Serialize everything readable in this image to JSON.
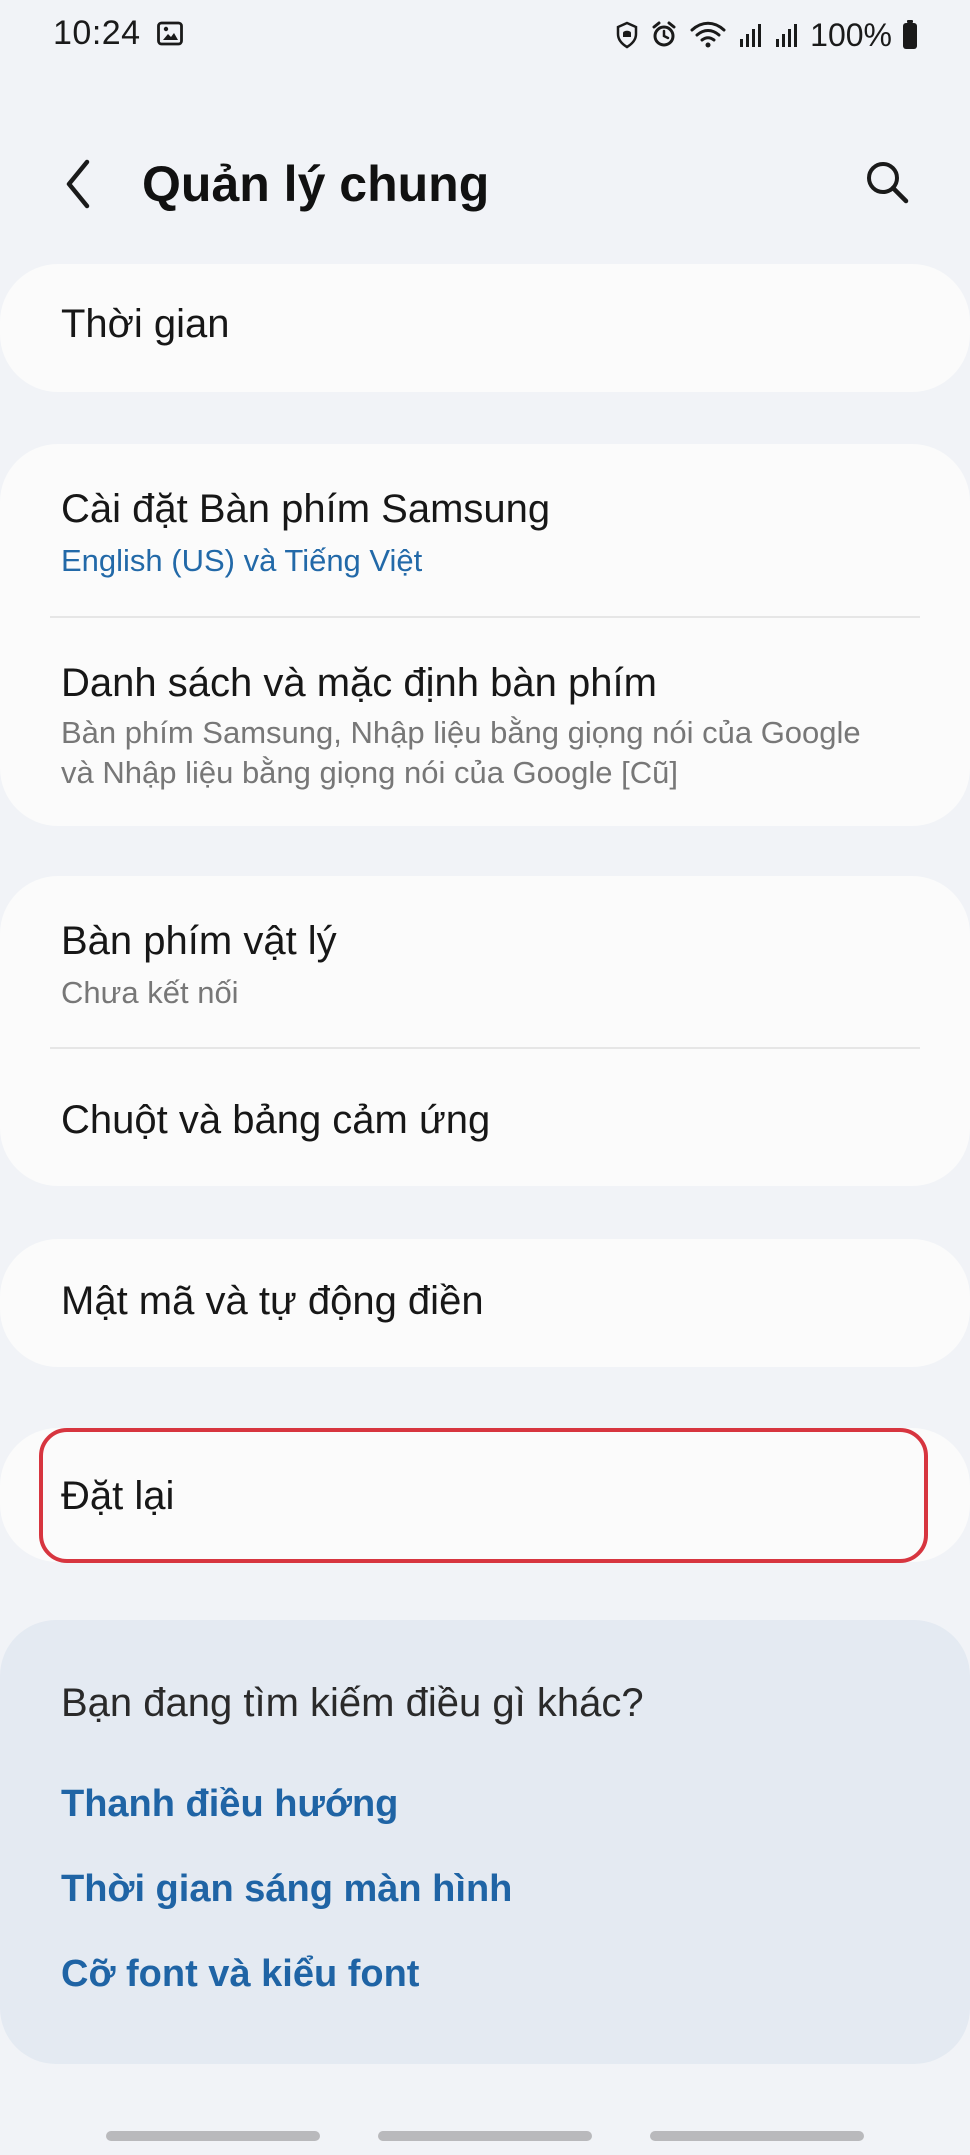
{
  "status_bar": {
    "time": "10:24",
    "battery": "100%",
    "icons": [
      "image-icon",
      "privacy-icon",
      "alarm-icon",
      "wifi-icon",
      "signal-icon",
      "signal-icon",
      "battery-icon"
    ]
  },
  "header": {
    "title": "Quản lý chung",
    "back_icon": "back-icon",
    "search_icon": "search-icon"
  },
  "settings": {
    "time": {
      "title": "Thời gian"
    },
    "samsung_keyboard": {
      "title": "Cài đặt Bàn phím Samsung",
      "subtitle": "English (US) và Tiếng Việt"
    },
    "keyboard_list": {
      "title": "Danh sách và mặc định bàn phím",
      "subtitle_line1": "Bàn phím Samsung, Nhập liệu bằng giọng nói của Google",
      "subtitle_line2": "và Nhập liệu bằng giọng nói của Google [Cũ]"
    },
    "physical_keyboard": {
      "title": "Bàn phím vật lý",
      "subtitle": "Chưa kết nối"
    },
    "mouse_trackpad": {
      "title": "Chuột và bảng cảm ứng"
    },
    "password_autofill": {
      "title": "Mật mã và tự động điền"
    },
    "reset": {
      "title": "Đặt lại"
    }
  },
  "suggestions": {
    "title": "Bạn đang tìm kiếm điều gì khác?",
    "links": [
      "Thanh điều hướng",
      "Thời gian sáng màn hình",
      "Cỡ font và kiểu font"
    ]
  },
  "colors": {
    "background": "#f1f3f7",
    "card": "#fbfbfb",
    "suggestion_card": "#e4eaf2",
    "accent_blue": "#1f64a5",
    "highlight_red": "#d7353f",
    "secondary_text": "#777777"
  }
}
